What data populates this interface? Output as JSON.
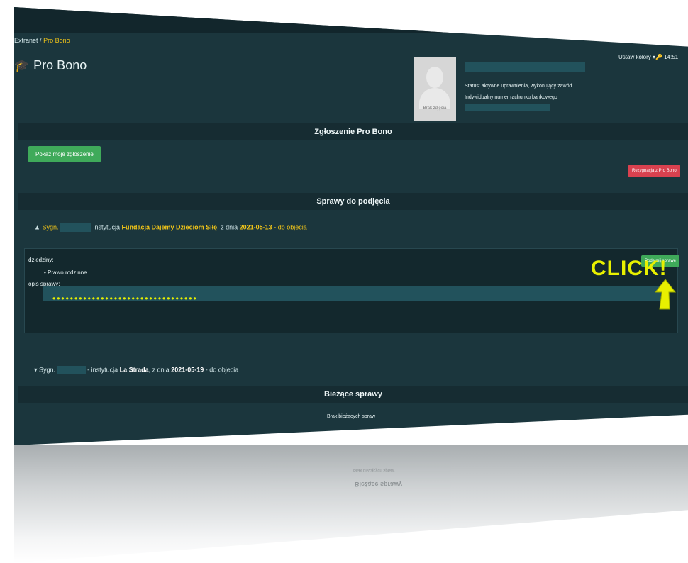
{
  "breadcrumb": {
    "root": "Extranet",
    "separator": "/",
    "current": "Pro Bono"
  },
  "header": {
    "title": "Pro Bono",
    "colors_label": "Ustaw kolory ▾",
    "clock": "14:51"
  },
  "profile": {
    "photo_label": "Brak zdjęcia",
    "status_text": "Status: aktywne uprawnienia, wykonujący zawód",
    "account_text": "Indywidualny numer rachunku bankowego"
  },
  "sections": {
    "submission_title": "Zgłoszenie Pro Bono",
    "cases_title": "Sprawy do podjęcia",
    "current_title": "Bieżące sprawy"
  },
  "buttons": {
    "show_submission": "Pokaż moje zgłoszenie",
    "resign": "Rezygnacja z Pro Bono",
    "take_case": "Podejmij sprawę"
  },
  "cases": [
    {
      "toggle": "▲",
      "prefix": "Sygn.",
      "institution_label": "instytucja",
      "institution": "Fundacja Dajemy Dzieciom Siłę",
      "date_label": ", z dnia",
      "date": "2021-05-13",
      "suffix": "- do objecia",
      "domains_label": "dziedziny:",
      "domains": [
        "Prawo rodzinne"
      ],
      "desc_label": "opis sprawy:"
    },
    {
      "toggle": "▾",
      "prefix": "Sygn.",
      "institution_label": "- instytucja",
      "institution": "La Strada",
      "date_label": ", z dnia",
      "date": "2021-05-19",
      "suffix": "- do objecia"
    }
  ],
  "current_cases_empty": "Brak bieżących spraw",
  "annotation": {
    "text": "CLICK!",
    "dots": "•••••••••••••••••••••••••••••••••"
  },
  "colors": {
    "bg": "#1b363d",
    "accent_yellow": "#f0c419",
    "green": "#3faa5a",
    "red": "#d9414f",
    "annotation": "#e8f000"
  }
}
